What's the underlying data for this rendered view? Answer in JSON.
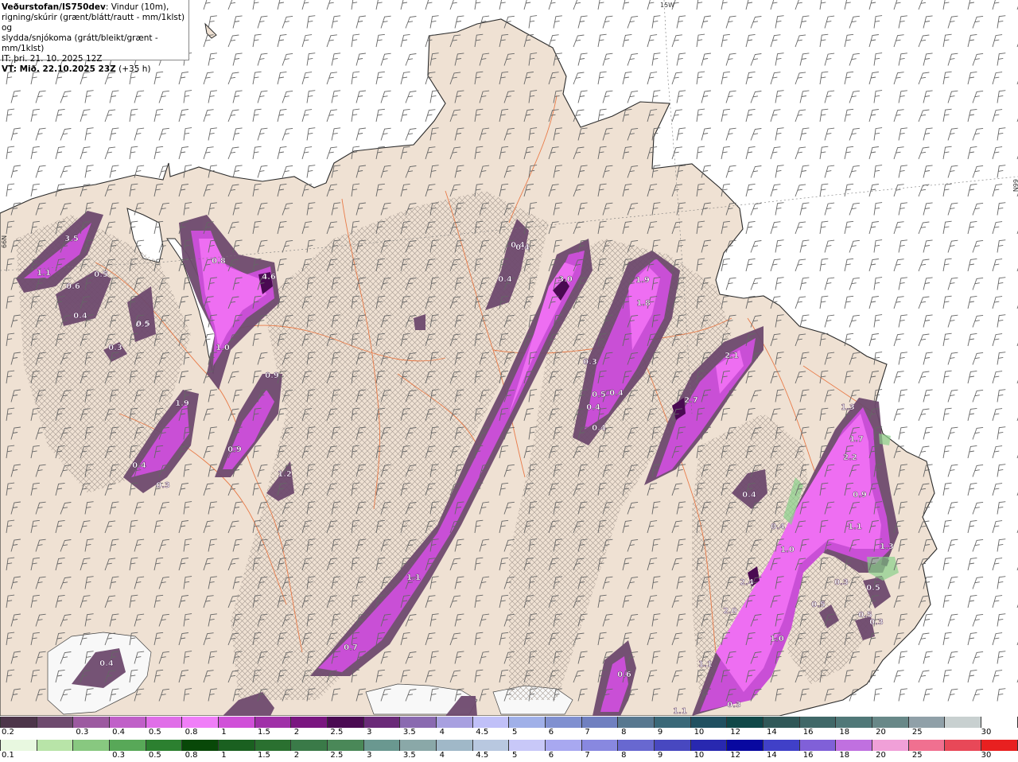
{
  "header": {
    "org": "Veðurstofan/IS750dev",
    "line1_rest": ": Vindur (10m),",
    "line2": "rigning/skúrir (grænt/blátt/rautt - mm/1klst) og",
    "line3": "slydda/snjókoma (grátt/bleikt/grænt - mm/1klst)",
    "line4": "IT: þri. 21. 10. 2025 12Z",
    "vt_label": "VT: Mið. 22.10.2025 23Z",
    "vt_rest": " (+35 h)"
  },
  "map": {
    "grid_labels": [
      "15W",
      "66N",
      "66N"
    ],
    "colors": {
      "sea": "#ffffff",
      "land": "#efe1d3",
      "coast": "#2a2a2a",
      "roads": "#e8703a",
      "wind_barbs": "#666666",
      "precip_light": "#6e4a6e",
      "precip_mid": "#c94fd6",
      "precip_high": "#ee6ef2",
      "precip_peak": "#4a0a52",
      "snow_patch": "#f8f8f8"
    },
    "precip_labels": [
      "3.5",
      "1.1",
      "0.6",
      "0.5",
      "0.4",
      "0.5",
      "0.3",
      "0.5",
      "0.8",
      "4.6",
      "1.0",
      "0.9",
      "1.9",
      "0.4",
      "0.3",
      "0.9",
      "1.2",
      "0.4",
      "0.4",
      "0.4",
      "3.0",
      "0.3",
      "0.5",
      "0.4",
      "1.1",
      "0.7",
      "1.9",
      "1.8",
      "0.3",
      "0.4",
      "0.4",
      "0.4",
      "2.1",
      "2.7",
      "0.4",
      "1.3",
      "1.7",
      "2.2",
      "0.9",
      "1.1",
      "1.3",
      "0.5",
      "1.0",
      "2.4",
      "2.0",
      "0.3",
      "0.5",
      "0.5",
      "0.3",
      "1.0",
      "1.1",
      "0.6",
      "1.1",
      "0.3",
      "0.4"
    ]
  },
  "legend_snow": {
    "colors": [
      "#4d354a",
      "#6e4a6e",
      "#9c5aa0",
      "#c060c8",
      "#e06ee8",
      "#f07ef8",
      "#d050d8",
      "#a030a8",
      "#7a1680",
      "#4a0a52",
      "#6a2a78",
      "#8a6ab0",
      "#a8a0e0",
      "#c0c0f8",
      "#a0b0e8",
      "#8090d0",
      "#7080c0",
      "#587890",
      "#3a6878",
      "#205060",
      "#104848",
      "#305858",
      "#406868",
      "#507878",
      "#688888",
      "#90a0a8",
      "#c8d0d0",
      "#ffffff"
    ],
    "labels": [
      "0.2",
      "0.3",
      "0.4",
      "0.5",
      "0.8",
      "1",
      "1.5",
      "2",
      "2.5",
      "3",
      "3.5",
      "4",
      "4.5",
      "5",
      "6",
      "7",
      "8",
      "9",
      "10",
      "12",
      "14",
      "16",
      "18",
      "20",
      "25",
      "30"
    ]
  },
  "legend_rain": {
    "colors": [
      "#e8f8e0",
      "#b8e4a8",
      "#88c880",
      "#58a858",
      "#2c8030",
      "#084808",
      "#1a6020",
      "#2a7030",
      "#3a7a48",
      "#4a8858",
      "#6a9890",
      "#8aa8a8",
      "#a0b8c8",
      "#b8c8e0",
      "#c8c8f8",
      "#a8a8f0",
      "#8888e0",
      "#6868d0",
      "#4848c0",
      "#2828b0",
      "#0808a0",
      "#4040c8",
      "#8060d8",
      "#c070e0",
      "#f0a0d8",
      "#f07090",
      "#e84858",
      "#e82020"
    ],
    "labels": [
      "0.1",
      "0.3",
      "0.5",
      "0.8",
      "1",
      "1.5",
      "2",
      "2.5",
      "3",
      "3.5",
      "4",
      "4.5",
      "5",
      "6",
      "7",
      "8",
      "9",
      "10",
      "12",
      "14",
      "16",
      "18",
      "20",
      "25",
      "30"
    ]
  }
}
